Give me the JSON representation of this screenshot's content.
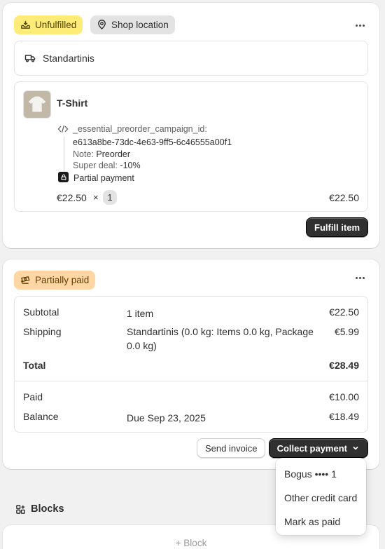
{
  "fulfillment": {
    "status_badge": "Unfulfilled",
    "location_badge": "Shop location",
    "shipping_method": "Standartinis",
    "item": {
      "title": "T-Shirt",
      "property_key": "_essential_preorder_campaign_id:",
      "property_value": "e613a8be-73dc-4e63-9ff5-6c46555a00f1",
      "note_label": "Note:",
      "note_value": "Preorder",
      "deal_label": "Super deal:",
      "deal_value": "-10%",
      "partial_payment_label": "Partial payment",
      "unit_price": "€22.50",
      "times": "×",
      "quantity": "1",
      "line_total": "€22.50"
    },
    "fulfill_button": "Fulfill item"
  },
  "payment": {
    "status_badge": "Partially paid",
    "rows": {
      "subtotal": {
        "label": "Subtotal",
        "detail": "1 item",
        "value": "€22.50"
      },
      "shipping": {
        "label": "Shipping",
        "detail": "Standartinis (0.0 kg: Items 0.0 kg, Package 0.0 kg)",
        "value": "€5.99"
      },
      "total": {
        "label": "Total",
        "value": "€28.49"
      },
      "paid": {
        "label": "Paid",
        "value": "€10.00"
      },
      "balance": {
        "label": "Balance",
        "detail": "Due Sep 23, 2025",
        "value": "€18.49"
      }
    },
    "send_invoice_button": "Send invoice",
    "collect_payment_button": "Collect payment",
    "collect_menu": [
      "Bogus •••• 1",
      "Other credit card",
      "Mark as paid"
    ]
  },
  "blocks": {
    "title": "Blocks",
    "add_block": "+ Block"
  },
  "colors": {
    "unfulfilled_badge": "#ffeb78",
    "partially_paid_badge": "#ffd6a4",
    "primary_button": "#303030"
  },
  "icons": {
    "unfulfilled": "inbox-icon",
    "location": "location-pin-icon",
    "shipping": "truck-icon",
    "property": "code-icon",
    "partial_payment": "lock-icon",
    "partially_paid": "cash-icon",
    "menu": "more-horizontal-icon",
    "blocks": "blocks-icon",
    "collect_chevron": "chevron-down-icon"
  }
}
